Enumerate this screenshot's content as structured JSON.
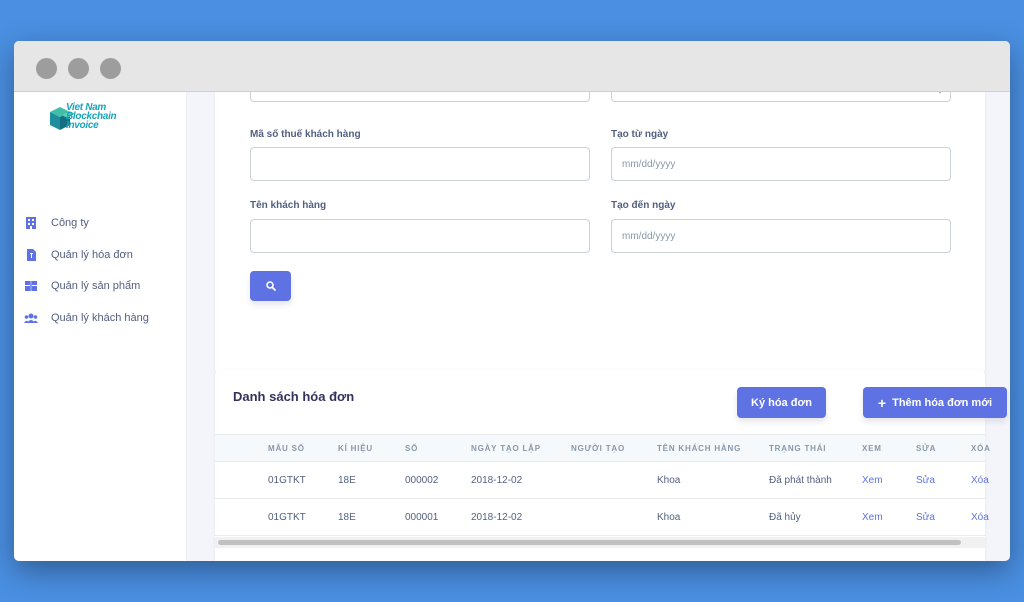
{
  "sidebar": {
    "logo_lines": [
      "Viet Nam",
      "Blockchain",
      "Invoice"
    ],
    "items": [
      {
        "label": "Công ty",
        "icon": "building-icon"
      },
      {
        "label": "Quản lý hóa đơn",
        "icon": "file-invoice-icon"
      },
      {
        "label": "Quản lý sản phẩm",
        "icon": "box-icon"
      },
      {
        "label": "Quản lý khách hàng",
        "icon": "users-icon"
      }
    ]
  },
  "search_form": {
    "tax_code_label": "Mã số thuế khách hàng",
    "from_date_label": "Tạo từ ngày",
    "from_date_placeholder": "mm/dd/yyyy",
    "customer_name_label": "Tên khách hàng",
    "to_date_label": "Tạo đến ngày",
    "to_date_placeholder": "mm/dd/yyyy"
  },
  "invoice_list": {
    "title": "Danh sách hóa đơn",
    "sign_button": "Ký hóa đơn",
    "add_button": "Thêm hóa đơn mới",
    "columns": [
      "MẪU SỐ",
      "KÍ HIỆU",
      "SỐ",
      "NGÀY TẠO LẬP",
      "NGƯỜI TẠO",
      "TÊN KHÁCH HÀNG",
      "TRẠNG THÁI",
      "XEM",
      "SỬA",
      "XÓA"
    ],
    "rows": [
      [
        "01GTKT",
        "18E",
        "000002",
        "2018-12-02",
        "",
        "Khoa",
        "Đã phát thành",
        "Xem",
        "Sửa",
        "Xóa"
      ],
      [
        "01GTKT",
        "18E",
        "000001",
        "2018-12-02",
        "",
        "Khoa",
        "Đã hủy",
        "Xem",
        "Sửa",
        "Xóa"
      ]
    ]
  },
  "colors": {
    "background": "#4a8fe2",
    "primary": "#5e72e4",
    "text": "#525f7f",
    "logo": "#17a4b8"
  }
}
